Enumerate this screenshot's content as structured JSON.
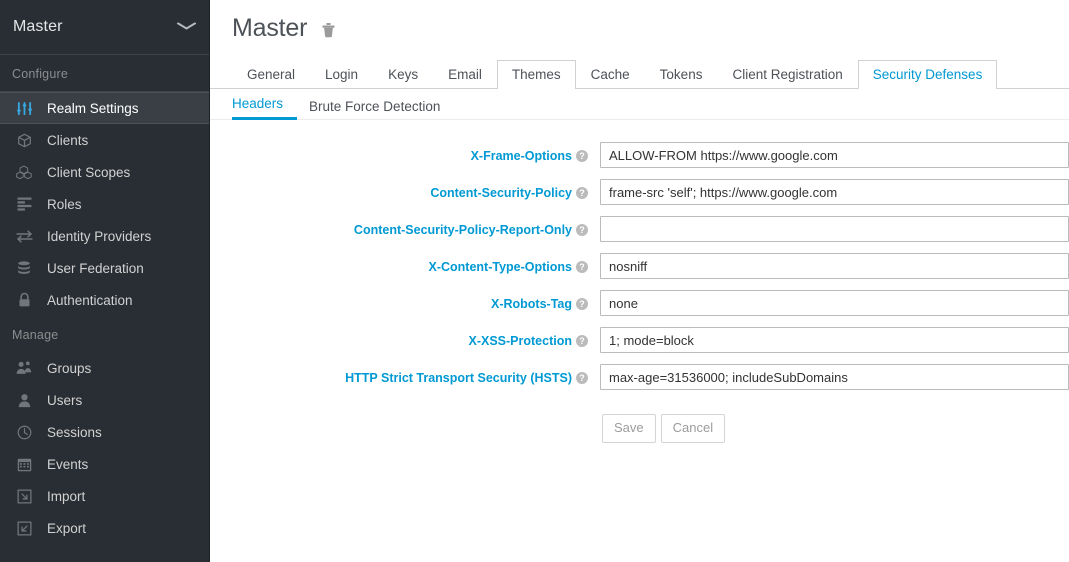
{
  "sidebar": {
    "realm": {
      "name": "Master",
      "caret_icon": "chevron-down-icon"
    },
    "sections": [
      {
        "title": "Configure",
        "items": [
          {
            "label": "Realm Settings",
            "icon": "sliders-icon",
            "active": true
          },
          {
            "label": "Clients",
            "icon": "cube-icon",
            "active": false
          },
          {
            "label": "Client Scopes",
            "icon": "cubes-icon",
            "active": false
          },
          {
            "label": "Roles",
            "icon": "list-icon",
            "active": false
          },
          {
            "label": "Identity Providers",
            "icon": "exchange-arrows-icon",
            "active": false
          },
          {
            "label": "User Federation",
            "icon": "database-icon",
            "active": false
          },
          {
            "label": "Authentication",
            "icon": "lock-icon",
            "active": false
          }
        ]
      },
      {
        "title": "Manage",
        "items": [
          {
            "label": "Groups",
            "icon": "users-group-icon",
            "active": false
          },
          {
            "label": "Users",
            "icon": "user-icon",
            "active": false
          },
          {
            "label": "Sessions",
            "icon": "clock-icon",
            "active": false
          },
          {
            "label": "Events",
            "icon": "calendar-icon",
            "active": false
          },
          {
            "label": "Import",
            "icon": "import-arrow-icon",
            "active": false
          },
          {
            "label": "Export",
            "icon": "export-arrow-icon",
            "active": false
          }
        ]
      }
    ]
  },
  "header": {
    "title": "Master",
    "delete_icon": "trash-icon"
  },
  "tabs": {
    "primary": [
      {
        "label": "General",
        "state": "normal"
      },
      {
        "label": "Login",
        "state": "normal"
      },
      {
        "label": "Keys",
        "state": "normal"
      },
      {
        "label": "Email",
        "state": "normal"
      },
      {
        "label": "Themes",
        "state": "hover"
      },
      {
        "label": "Cache",
        "state": "normal"
      },
      {
        "label": "Tokens",
        "state": "normal"
      },
      {
        "label": "Client Registration",
        "state": "normal"
      },
      {
        "label": "Security Defenses",
        "state": "active"
      }
    ],
    "sub": [
      {
        "label": "Headers",
        "state": "active"
      },
      {
        "label": "Brute Force Detection",
        "state": "normal"
      }
    ]
  },
  "form": {
    "help_glyph": "?",
    "fields": [
      {
        "label": "X-Frame-Options",
        "value": "ALLOW-FROM https://www.google.com",
        "placeholder": "",
        "help_icon": "help-circle-icon"
      },
      {
        "label": "Content-Security-Policy",
        "value": "frame-src 'self'; https://www.google.com",
        "placeholder": "",
        "help_icon": "help-circle-icon"
      },
      {
        "label": "Content-Security-Policy-Report-Only",
        "value": "",
        "placeholder": "",
        "help_icon": "help-circle-icon"
      },
      {
        "label": "X-Content-Type-Options",
        "value": "nosniff",
        "placeholder": "",
        "help_icon": "help-circle-icon"
      },
      {
        "label": "X-Robots-Tag",
        "value": "none",
        "placeholder": "",
        "help_icon": "help-circle-icon"
      },
      {
        "label": "X-XSS-Protection",
        "value": "1; mode=block",
        "placeholder": "",
        "help_icon": "help-circle-icon"
      },
      {
        "label": "HTTP Strict Transport Security (HSTS)",
        "value": "max-age=31536000; includeSubDomains",
        "placeholder": "",
        "help_icon": "help-circle-icon"
      }
    ],
    "save_label": "Save",
    "cancel_label": "Cancel",
    "buttons_disabled": true
  },
  "colors": {
    "sidebar_bg": "#292e34",
    "sidebar_active_bg": "#393f45",
    "accent_blue": "#0099d3",
    "icon_blue": "#39a5dc",
    "label_blue": "#0099d3",
    "title_gray": "#4d5258"
  }
}
